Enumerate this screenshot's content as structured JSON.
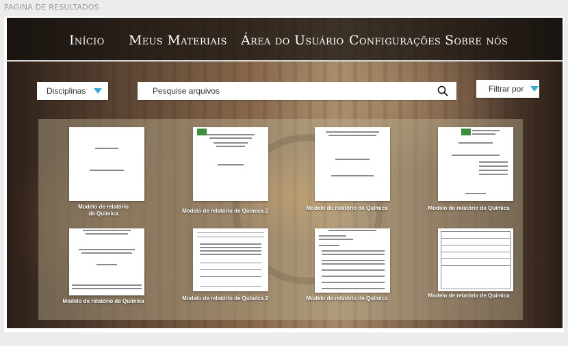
{
  "page_label": "PAGINA DE RESULTADOS",
  "nav": {
    "items": [
      "Início",
      "Meus Materiais",
      "Área do Usuário",
      "Configurações",
      "Sobre nós"
    ]
  },
  "filters": {
    "disciplinas_label": "Disciplinas",
    "search_placeholder": "Pesquise arquivos",
    "filtrar_label": "Filtrar por"
  },
  "results": [
    {
      "title": "Modelo de relatório de Química"
    },
    {
      "title": "Modelo de relatório de Química 2"
    },
    {
      "title": "Modelo de relatório de Química"
    },
    {
      "title": "Modelo de relatório de Química"
    },
    {
      "title": "Modelo de relatório de Química"
    },
    {
      "title": "Modelo de relatório de Química 2"
    },
    {
      "title": "Modelo de relatório de Química"
    },
    {
      "title": "Modelo de relatório de Química"
    }
  ],
  "colors": {
    "accent": "#3aa9d6",
    "navbar": "#141010",
    "page_bg": "#ececec"
  },
  "icons": {
    "dropdown": "triangle-down-icon",
    "search": "search-icon"
  }
}
